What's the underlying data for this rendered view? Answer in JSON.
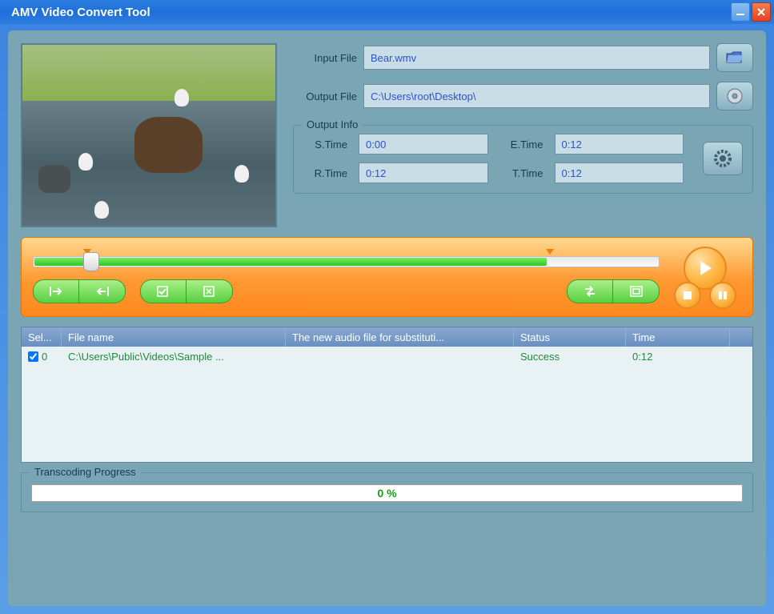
{
  "window": {
    "title": "AMV Video Convert Tool"
  },
  "files": {
    "input_label": "Input File",
    "input_value": "Bear.wmv",
    "output_label": "Output File",
    "output_value": "C:\\Users\\root\\Desktop\\"
  },
  "output_info": {
    "legend": "Output Info",
    "stime_label": "S.Time",
    "stime_value": "0:00",
    "etime_label": "E.Time",
    "etime_value": "0:12",
    "rtime_label": "R.Time",
    "rtime_value": "0:12",
    "ttime_label": "T.Time",
    "ttime_value": "0:12"
  },
  "table": {
    "headers": {
      "sel": "Sel...",
      "fname": "File name",
      "audio": "The new audio file for substituti...",
      "status": "Status",
      "time": "Time"
    },
    "rows": [
      {
        "checked": true,
        "index": "0",
        "fname": "C:\\Users\\Public\\Videos\\Sample ...",
        "audio": "",
        "status": "Success",
        "time": "0:12"
      }
    ]
  },
  "progress": {
    "legend": "Transcoding Progress",
    "text": "0 %"
  }
}
